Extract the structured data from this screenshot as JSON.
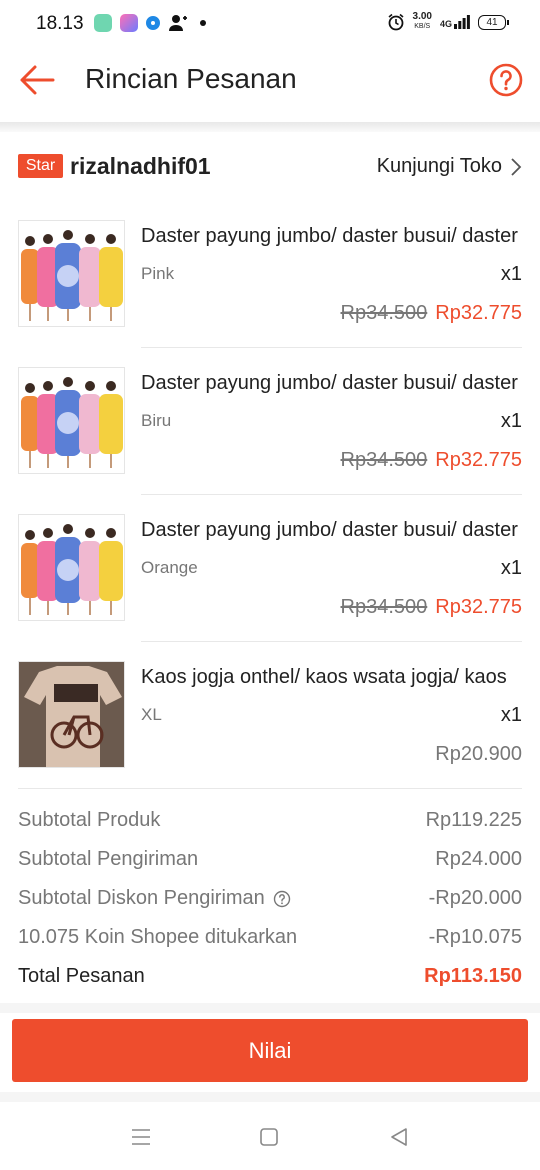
{
  "status_bar": {
    "time": "18.13",
    "speed_value": "3.00",
    "speed_unit": "KB/S",
    "network": "4G",
    "battery": "41"
  },
  "header": {
    "title": "Rincian Pesanan",
    "back_icon": "arrow-left-icon",
    "help_icon": "question-circle-icon"
  },
  "shop": {
    "badge": "Star",
    "name": "rizalnadhif01",
    "visit_label": "Kunjungi Toko"
  },
  "items": [
    {
      "name": "Daster payung jumbo/ daster busui/ daster",
      "variant": "Pink",
      "qty": "x1",
      "old_price": "Rp34.500",
      "price": "Rp32.775"
    },
    {
      "name": "Daster payung jumbo/ daster busui/ daster",
      "variant": "Biru",
      "qty": "x1",
      "old_price": "Rp34.500",
      "price": "Rp32.775"
    },
    {
      "name": "Daster payung jumbo/ daster busui/ daster",
      "variant": "Orange",
      "qty": "x1",
      "old_price": "Rp34.500",
      "price": "Rp32.775"
    },
    {
      "name": "Kaos jogja onthel/ kaos wsata jogja/ kaos",
      "variant": "XL",
      "qty": "x1",
      "price": "Rp20.900"
    }
  ],
  "summary": {
    "subtotal_product_label": "Subtotal Produk",
    "subtotal_product_value": "Rp119.225",
    "subtotal_shipping_label": "Subtotal Pengiriman",
    "subtotal_shipping_value": "Rp24.000",
    "shipping_discount_label": "Subtotal Diskon Pengiriman",
    "shipping_discount_value": "-Rp20.000",
    "coins_label": "10.075 Koin Shopee ditukarkan",
    "coins_value": "-Rp10.075",
    "total_label": "Total Pesanan",
    "total_value": "Rp113.150"
  },
  "action": {
    "rate_label": "Nilai"
  },
  "colors": {
    "accent": "#ee4d2d"
  }
}
